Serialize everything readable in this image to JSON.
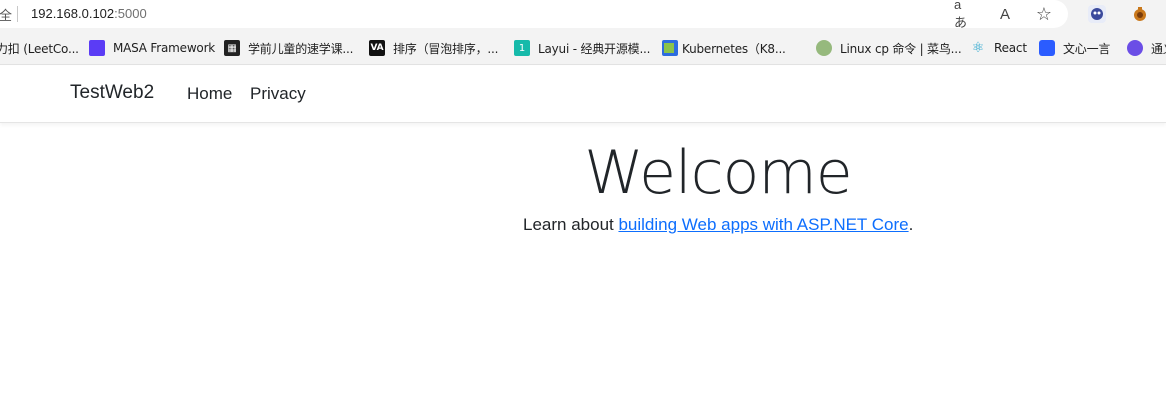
{
  "browser": {
    "secure_fragment": "全",
    "url_host": "192.168.0.102",
    "url_port": ":5000",
    "icons": [
      "read-aloud-icon",
      "text-size-icon",
      "favorite-star-icon",
      "copilot-icon",
      "extension-icon"
    ],
    "read_aloud_glyph": "aあ",
    "text_glyph": "A",
    "star_glyph": "☆"
  },
  "favorites": [
    {
      "label": "力扣 (LeetCo...",
      "icon": "leetcode-icon",
      "color": "#f3f3f3"
    },
    {
      "label": "MASA Framework",
      "icon": "masa-icon",
      "color": "#5b3cf5"
    },
    {
      "label": "学前儿童的速学课...",
      "icon": "qr-icon",
      "color": "#222222"
    },
    {
      "label": "排序（冒泡排序，...",
      "icon": "va-icon",
      "color": "#111111"
    },
    {
      "label": "Layui - 经典开源模...",
      "icon": "layui-icon",
      "color": "#16baaa"
    },
    {
      "label": "Kubernetes（K8...",
      "icon": "k8s-icon",
      "color": "#2d6cdf"
    },
    {
      "label": "Linux cp 命令 | 菜鸟...",
      "icon": "runoob-icon",
      "color": "#96b97d"
    },
    {
      "label": "React",
      "icon": "react-icon",
      "color": "#61dafb"
    },
    {
      "label": "文心一言",
      "icon": "wenxin-icon",
      "color": "#2b5cff"
    },
    {
      "label": "通义",
      "icon": "tongyi-icon",
      "color": "#6b4ee6"
    }
  ],
  "site": {
    "brand": "TestWeb2",
    "nav": [
      "Home",
      "Privacy"
    ]
  },
  "main": {
    "heading": "Welcome",
    "learn_prefix": "Learn about ",
    "learn_link": "building Web apps with ASP.NET Core",
    "learn_suffix": "."
  }
}
